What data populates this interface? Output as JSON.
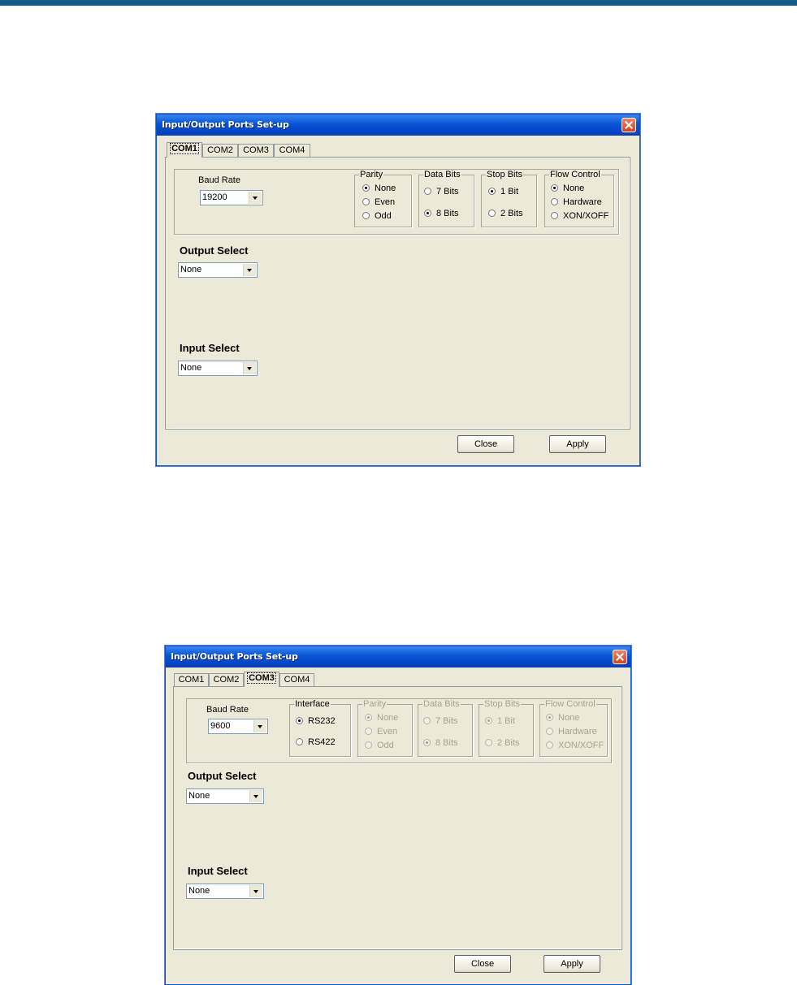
{
  "dialog1": {
    "title": "Input/Output Ports Set-up",
    "tabs": [
      "COM1",
      "COM2",
      "COM3",
      "COM4"
    ],
    "active_tab": "COM1",
    "baud_label": "Baud Rate",
    "baud_value": "19200",
    "parity": {
      "label": "Parity",
      "options": [
        "None",
        "Even",
        "Odd"
      ],
      "selected": "None"
    },
    "data_bits": {
      "label": "Data Bits",
      "options": [
        "7 Bits",
        "8 Bits"
      ],
      "selected": "8 Bits"
    },
    "stop_bits": {
      "label": "Stop Bits",
      "options": [
        "1 Bit",
        "2 Bits"
      ],
      "selected": "1 Bit"
    },
    "flow_control": {
      "label": "Flow Control",
      "options": [
        "None",
        "Hardware",
        "XON/XOFF"
      ],
      "selected": "None"
    },
    "output_select_label": "Output Select",
    "output_select_value": "None",
    "input_select_label": "Input Select",
    "input_select_value": "None",
    "close_label": "Close",
    "apply_label": "Apply"
  },
  "dialog2": {
    "title": "Input/Output Ports Set-up",
    "tabs": [
      "COM1",
      "COM2",
      "COM3",
      "COM4"
    ],
    "active_tab": "COM3",
    "baud_label": "Baud Rate",
    "baud_value": "9600",
    "interface": {
      "label": "Interface",
      "options": [
        "RS232",
        "RS422"
      ],
      "selected": "RS232"
    },
    "parity": {
      "label": "Parity",
      "options": [
        "None",
        "Even",
        "Odd"
      ],
      "selected": "None",
      "disabled": true
    },
    "data_bits": {
      "label": "Data Bits",
      "options": [
        "7 Bits",
        "8 Bits"
      ],
      "selected": "8 Bits",
      "disabled": true
    },
    "stop_bits": {
      "label": "Stop Bits",
      "options": [
        "1 Bit",
        "2 Bits"
      ],
      "selected": "1 Bit",
      "disabled": true
    },
    "flow_control": {
      "label": "Flow Control",
      "options": [
        "None",
        "Hardware",
        "XON/XOFF"
      ],
      "selected": "None",
      "disabled": true
    },
    "output_select_label": "Output Select",
    "output_select_value": "None",
    "input_select_label": "Input Select",
    "input_select_value": "None",
    "close_label": "Close",
    "apply_label": "Apply"
  },
  "colors": {
    "top_bar": "#0f5d88",
    "title_bar": "#0754d6",
    "dialog_bg": "#ece9d8",
    "close_button": "#d5431f"
  },
  "icons": {
    "close": "close-icon",
    "dropdown": "chevron-down-icon"
  }
}
